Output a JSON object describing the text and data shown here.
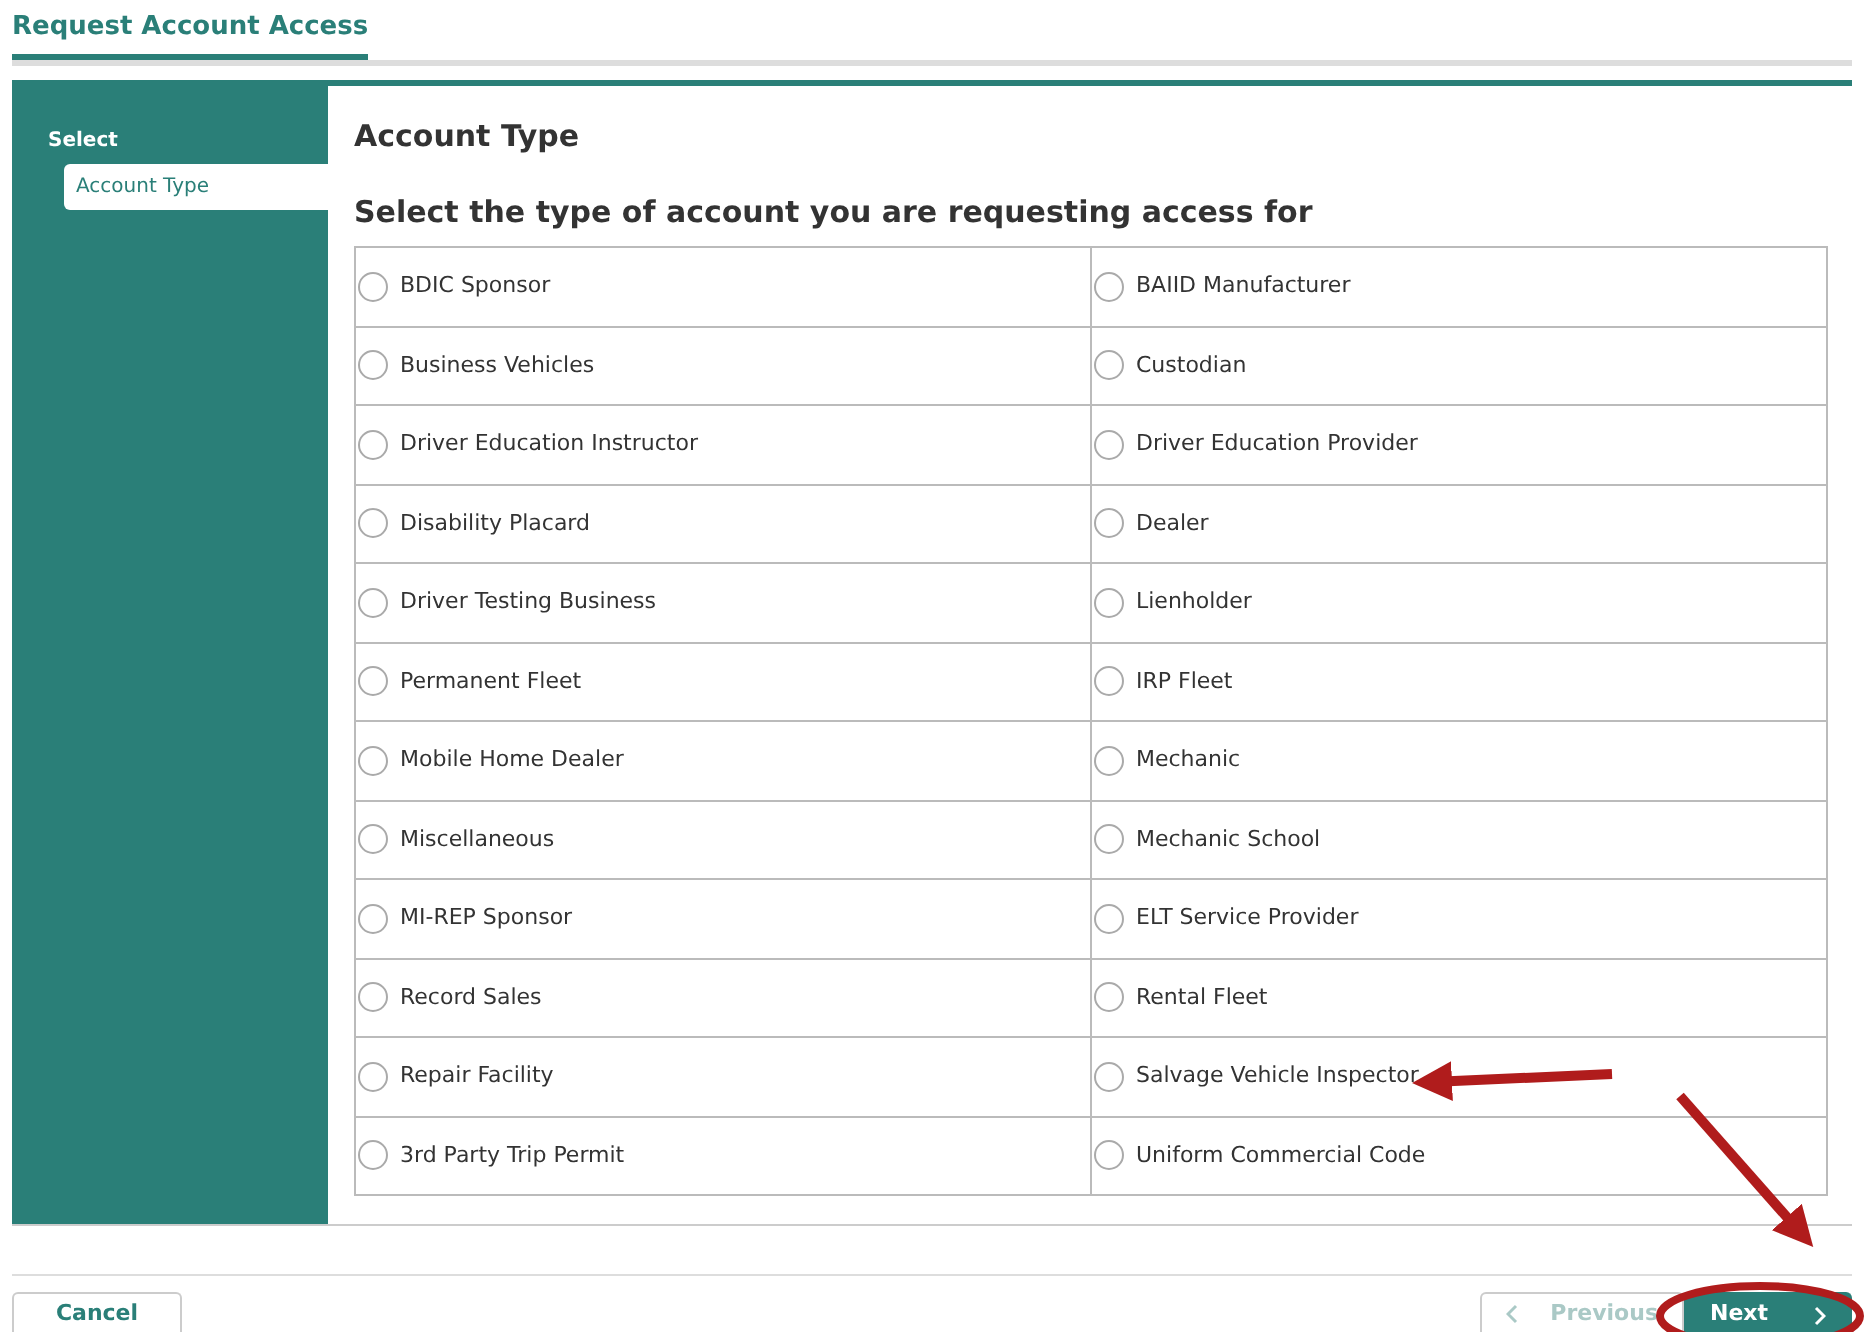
{
  "header_tab": {
    "label": "Request Account Access",
    "selected": true
  },
  "sidebar": {
    "title": "Select",
    "items": [
      {
        "label": "Account Type",
        "selected": true
      }
    ]
  },
  "section_title": "Account Type",
  "question": "Select the type of account you are requesting access for",
  "options": [
    {
      "label": "BDIC Sponsor",
      "selected": false
    },
    {
      "label": "BAIID Manufacturer",
      "selected": false
    },
    {
      "label": "Business Vehicles",
      "selected": false
    },
    {
      "label": "Custodian",
      "selected": false
    },
    {
      "label": "Driver Education Instructor",
      "selected": false
    },
    {
      "label": "Driver Education Provider",
      "selected": false
    },
    {
      "label": "Disability Placard",
      "selected": false
    },
    {
      "label": "Dealer",
      "selected": false
    },
    {
      "label": "Driver Testing Business",
      "selected": false
    },
    {
      "label": "Lienholder",
      "selected": false
    },
    {
      "label": "Permanent Fleet",
      "selected": false
    },
    {
      "label": "IRP Fleet",
      "selected": false
    },
    {
      "label": "Mobile Home Dealer",
      "selected": false
    },
    {
      "label": "Mechanic",
      "selected": false
    },
    {
      "label": "Miscellaneous",
      "selected": false
    },
    {
      "label": "Mechanic School",
      "selected": false
    },
    {
      "label": "MI-REP Sponsor",
      "selected": false
    },
    {
      "label": "ELT Service Provider",
      "selected": false
    },
    {
      "label": "Record Sales",
      "selected": false
    },
    {
      "label": "Rental Fleet",
      "selected": false
    },
    {
      "label": "Repair Facility",
      "selected": false
    },
    {
      "label": "Salvage Vehicle Inspector",
      "selected": false
    },
    {
      "label": "3rd Party Trip Permit",
      "selected": false
    },
    {
      "label": "Uniform Commercial Code",
      "selected": false
    }
  ],
  "footer": {
    "cancel": "Cancel",
    "previous": {
      "label": "Previous",
      "disabled": true
    },
    "next": {
      "label": "Next",
      "disabled": false
    }
  }
}
